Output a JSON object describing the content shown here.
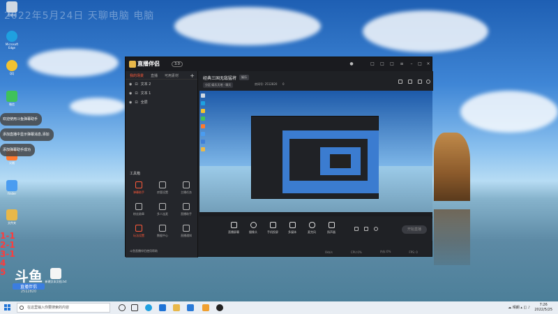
{
  "overlay_date": "2022年5月24日 天聊电脑 电脑",
  "desktop_icons": [
    {
      "label": "回收站",
      "color": "#cfd8e3"
    },
    {
      "label": "Microsoft Edge",
      "color": "#1fa0e0"
    },
    {
      "label": "QQ",
      "color": "#f2c230"
    },
    {
      "label": "微信",
      "color": "#3fc25a"
    },
    {
      "label": "火绒",
      "color": "#ff7a2f"
    },
    {
      "label": "Finder",
      "color": "#4a9cf0"
    },
    {
      "label": "Snipaste",
      "color": "#3f7fd9"
    },
    {
      "label": "直播伴侣",
      "color": "#f0c35b"
    },
    {
      "label": "文件夹",
      "color": "#e8b84a"
    }
  ],
  "chat_bubbles": [
    "欢迎使用斗鱼弹幕助手",
    "添加直播中显示弹幕消息,添加",
    "添加弹幕助手成功"
  ],
  "red_numbers": [
    "1-1",
    "2-1",
    "3-1",
    "4",
    "5"
  ],
  "brand": {
    "big": "斗鱼",
    "small": "直播伴侣",
    "num": "2512820"
  },
  "desktop_file": {
    "label": "新建文本文档.txt"
  },
  "app": {
    "title": "直播伴侣",
    "version": "3.0",
    "left_tabs": [
      "我的场景",
      "直播",
      "可用素材"
    ],
    "sources": [
      "文本 2",
      "文本 1",
      "全屏"
    ],
    "tools_title": "工具箱",
    "tools": [
      {
        "label": "弹幕助手",
        "on": true
      },
      {
        "label": "房管设置",
        "on": false
      },
      {
        "label": "主播任务",
        "on": false
      },
      {
        "label": "粉丝勋章",
        "on": false
      },
      {
        "label": "多人连麦",
        "on": false
      },
      {
        "label": "直播助手",
        "on": false
      },
      {
        "label": "玩法设置",
        "on": true
      },
      {
        "label": "数据中心",
        "on": false
      },
      {
        "label": "直播通知",
        "on": false
      }
    ],
    "footer": "斗鱼直播伴侣使用帮助",
    "room_title": "经典三国无敌猛将",
    "room_tag": "娱乐",
    "room_category": "分区:娱乐天地 - 聊天",
    "room_id": "房间号: 2512820",
    "room_heat": "0",
    "controls": [
      "直播屏幕",
      "摄像头",
      "手机投屏",
      "多媒体",
      "麦克风",
      "扬声器"
    ],
    "start_label": "开始直播",
    "status": [
      "0kb/s",
      "CPU:0%",
      "内存:0%",
      "FPS: 0"
    ]
  },
  "taskbar": {
    "search_placeholder": "在这里输入你要搜索的内容",
    "tray_weather": "晴朗",
    "time": "7:26",
    "date": "2022/5/25"
  }
}
